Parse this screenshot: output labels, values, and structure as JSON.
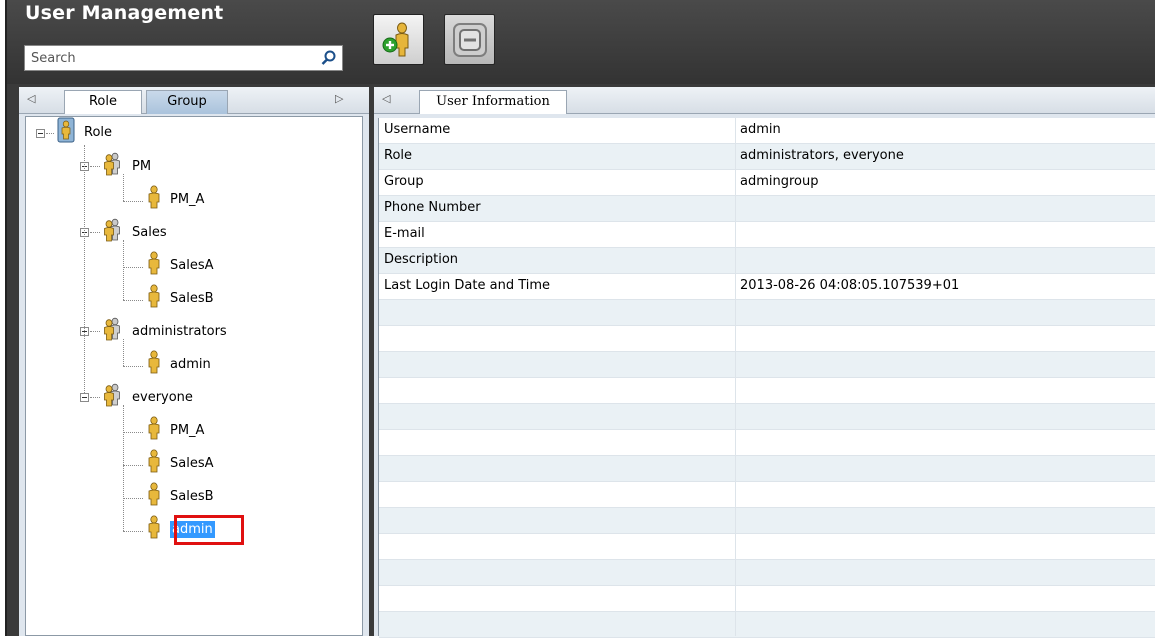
{
  "app": {
    "title": "User Management"
  },
  "search": {
    "placeholder": "Search"
  },
  "toolbar": {
    "add_icon": "add-user-icon",
    "remove_icon": "remove-icon"
  },
  "left_tabs": [
    "Role",
    "Group"
  ],
  "tree": {
    "root": "Role",
    "groups": [
      {
        "label": "PM",
        "children": [
          "PM_A"
        ]
      },
      {
        "label": "Sales",
        "children": [
          "SalesA",
          "SalesB"
        ]
      },
      {
        "label": "administrators",
        "children": [
          "admin"
        ]
      },
      {
        "label": "everyone",
        "children": [
          "PM_A",
          "SalesA",
          "SalesB",
          "admin"
        ]
      }
    ],
    "selected": "admin"
  },
  "right_tab": "User Information",
  "user_info": [
    {
      "key": "Username",
      "value": "admin"
    },
    {
      "key": "Role",
      "value": "administrators, everyone"
    },
    {
      "key": "Group",
      "value": "admingroup"
    },
    {
      "key": "Phone Number",
      "value": ""
    },
    {
      "key": "E-mail",
      "value": ""
    },
    {
      "key": "Description",
      "value": ""
    },
    {
      "key": "Last Login Date and Time",
      "value": "2013-08-26 04:08:05.107539+01"
    }
  ],
  "colors": {
    "selection": "#3399ff",
    "highlight_border": "#e01010",
    "header_bg": "#3a3a3a"
  }
}
